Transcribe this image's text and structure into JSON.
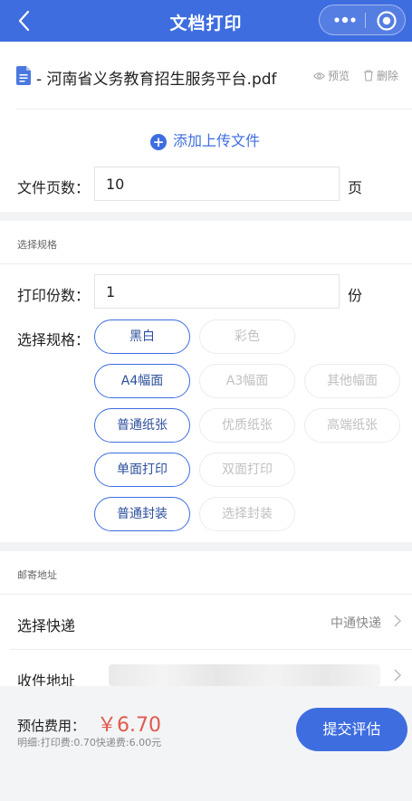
{
  "nav": {
    "title": "文档打印"
  },
  "file": {
    "name": "- 河南省义务教育招生服务平台.pdf",
    "preview_label": "预览",
    "delete_label": "删除"
  },
  "upload": {
    "add_label": "添加上传文件"
  },
  "pages": {
    "label": "文件页数：",
    "value": "10",
    "unit": "页"
  },
  "spec_section": {
    "title": "选择规格"
  },
  "copies": {
    "label": "打印份数：",
    "value": "1",
    "unit": "份"
  },
  "spec": {
    "label": "选择规格：",
    "groups": [
      {
        "options": [
          "黑白",
          "彩色"
        ],
        "selected": "黑白"
      },
      {
        "options": [
          "A4幅面",
          "A3幅面",
          "其他幅面"
        ],
        "selected": "A4幅面"
      },
      {
        "options": [
          "普通纸张",
          "优质纸张",
          "高端纸张"
        ],
        "selected": "普通纸张"
      },
      {
        "options": [
          "单面打印",
          "双面打印"
        ],
        "selected": "单面打印"
      },
      {
        "options": [
          "普通封装",
          "选择封装"
        ],
        "selected": "普通封装"
      }
    ]
  },
  "mail_section": {
    "title": "邮寄地址"
  },
  "express": {
    "label": "选择快递",
    "value": "中通快递"
  },
  "address": {
    "label": "收件地址"
  },
  "footer": {
    "fee_label": "预估费用：",
    "fee_amount": "￥6.70",
    "fee_detail": "明细:打印费:0.70快递费:6.00元",
    "submit_label": "提交评估"
  },
  "colors": {
    "primary": "#3e6de0",
    "price": "#e05a4e",
    "muted": "#999999",
    "band": "#f2f3f5"
  },
  "icons": [
    "back-icon",
    "more-dots-icon",
    "target-icon",
    "pdf-file-icon",
    "eye-icon",
    "trash-icon",
    "plus-circle-icon",
    "chevron-right-icon"
  ]
}
